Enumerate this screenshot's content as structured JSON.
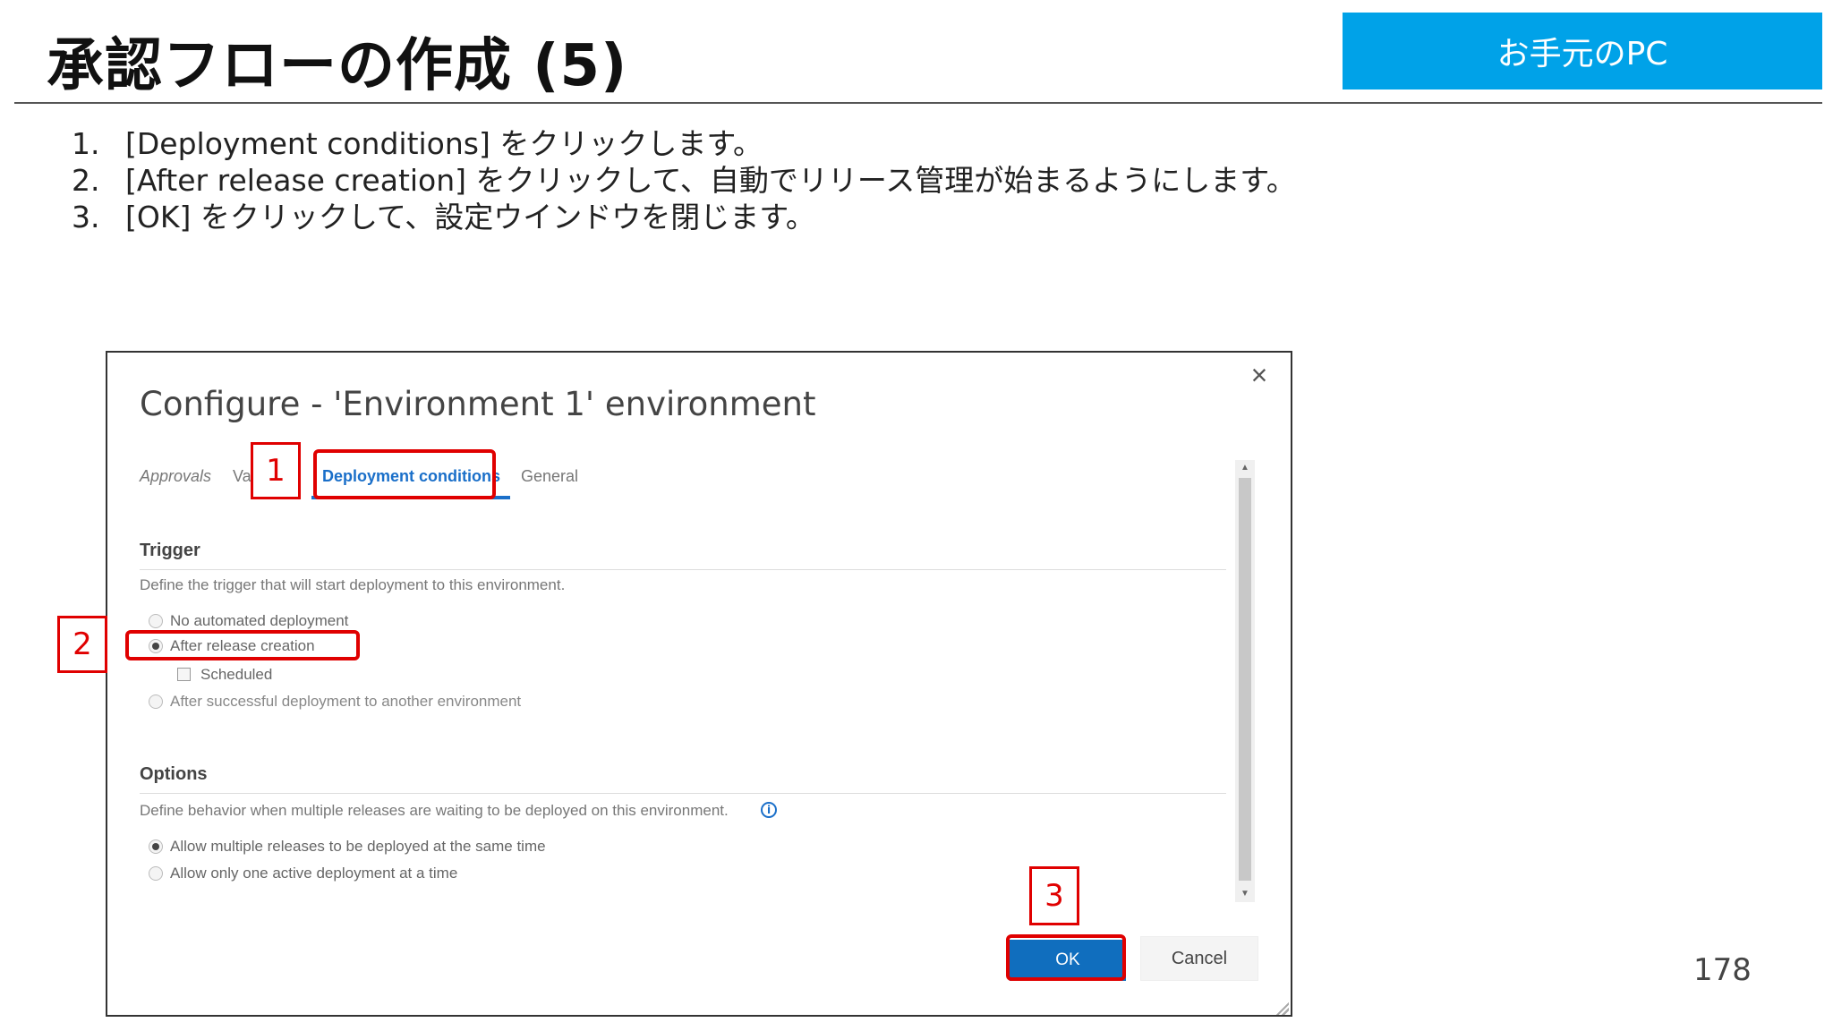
{
  "slide": {
    "title": "承認フローの作成 (5)",
    "badge": "お手元のPC",
    "page_number": "178",
    "steps": [
      {
        "num": "1.",
        "text": "[Deployment conditions] をクリックします。"
      },
      {
        "num": "2.",
        "text": "[After release creation] をクリックして、自動でリリース管理が始まるようにします。"
      },
      {
        "num": "3.",
        "text": "[OK] をクリックして、設定ウインドウを閉じます。"
      }
    ]
  },
  "dialog": {
    "title": "Configure - 'Environment 1' environment",
    "close_glyph": "×",
    "tabs": {
      "approvals": "Approvals",
      "variables": "Va",
      "deployment_conditions": "Deployment conditions",
      "general": "General"
    },
    "trigger": {
      "heading": "Trigger",
      "description": "Define the trigger that will start deployment to this environment.",
      "options": [
        {
          "label": "No automated deployment",
          "checked": false
        },
        {
          "label": "After release creation",
          "checked": true
        },
        {
          "label": "Scheduled",
          "checked": false
        },
        {
          "label": "After successful deployment to another environment",
          "checked": false
        }
      ]
    },
    "options": {
      "heading": "Options",
      "description": "Define behavior when multiple releases are waiting to be deployed on this environment.",
      "info_glyph": "i",
      "choices": [
        {
          "label": "Allow multiple releases to be deployed at the same time",
          "checked": true
        },
        {
          "label": "Allow only one active deployment at a time",
          "checked": false
        }
      ]
    },
    "scroll": {
      "up_glyph": "▲",
      "down_glyph": "▼"
    },
    "buttons": {
      "ok": "OK",
      "cancel": "Cancel"
    }
  },
  "callouts": {
    "one": "1",
    "two": "2",
    "three": "3"
  },
  "colors": {
    "badge_bg": "#00a2e8",
    "accent_blue": "#106ebe",
    "annotation_red": "#e00000"
  }
}
